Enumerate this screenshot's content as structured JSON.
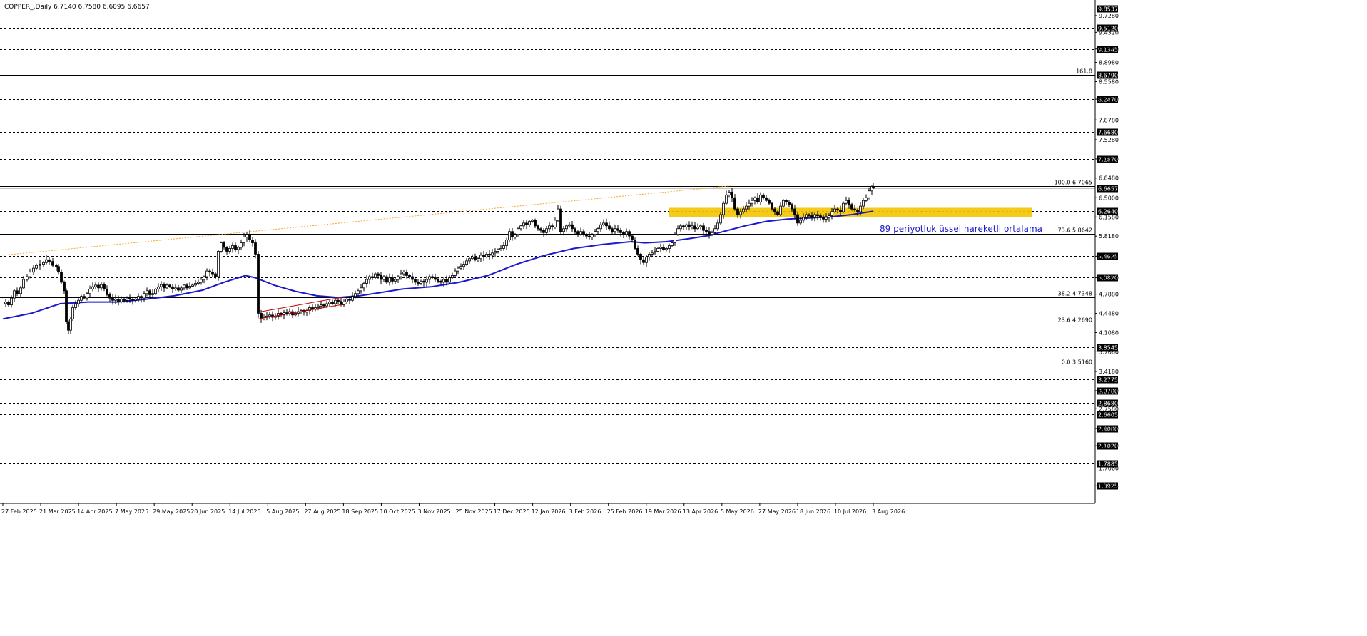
{
  "header": {
    "symbol_info": "COPPER_,Daily  6.7140 6.7580 6.6095 6.6657"
  },
  "chart_data": {
    "type": "candlestick",
    "title": "COPPER_,Daily  6.7140 6.7580 6.6095 6.6657",
    "ylim": [
      1.08,
      9.98
    ],
    "price_axis_ticks": [
      "9.7280",
      "9.4320",
      "9.1360",
      "8.8980",
      "8.5580",
      "8.2470",
      "7.8780",
      "7.5280",
      "7.1870",
      "6.8480",
      "6.5000",
      "6.1580",
      "5.8180",
      "5.4625",
      "5.0820",
      "4.7880",
      "4.4480",
      "4.1080",
      "3.7680",
      "3.4180",
      "3.0780",
      "2.7580",
      "2.4080",
      "2.1020",
      "1.7060",
      "1.3925"
    ],
    "price_axis_ticks_values": [
      9.728,
      9.432,
      9.136,
      8.898,
      8.558,
      8.247,
      7.878,
      7.528,
      7.187,
      6.848,
      6.5,
      6.158,
      5.818,
      5.4625,
      5.082,
      4.788,
      4.448,
      4.108,
      3.768,
      3.418,
      3.078,
      2.758,
      2.408,
      2.102,
      1.706,
      1.3925
    ],
    "x_axis_labels": [
      "27 Feb 2025",
      "21 Mar 2025",
      "14 Apr 2025",
      "7 May 2025",
      "29 May 2025",
      "20 Jun 2025",
      "14 Jul 2025",
      "5 Aug 2025",
      "27 Aug 2025",
      "18 Sep 2025",
      "10 Oct 2025",
      "3 Nov 2025",
      "25 Nov 2025",
      "17 Dec 2025",
      "12 Jan 2026",
      "3 Feb 2026",
      "25 Feb 2026",
      "19 Mar 2026",
      "13 Apr 2026",
      "5 May 2026",
      "27 May 2026",
      "18 Jun 2026",
      "10 Jul 2026",
      "3 Aug 2026"
    ],
    "horizontal_levels": [
      {
        "value": 9.8537,
        "label": "9.8537",
        "style": "dashed"
      },
      {
        "value": 9.512,
        "label": "9.5120",
        "style": "dashed"
      },
      {
        "value": 9.1345,
        "label": "9.1345",
        "style": "dashed"
      },
      {
        "value": 8.679,
        "label": "8.6790",
        "style": "solid",
        "note": "161.8"
      },
      {
        "value": 8.247,
        "label": "8.2470",
        "style": "dashed"
      },
      {
        "value": 7.668,
        "label": "7.6680",
        "style": "dashed"
      },
      {
        "value": 7.187,
        "label": "7.1870",
        "style": "dashed"
      },
      {
        "value": 6.7065,
        "label": "",
        "style": "solid",
        "note": "100.0 6.7065"
      },
      {
        "value": 6.6657,
        "label": "6.6657",
        "style": "none",
        "current": true
      },
      {
        "value": 6.264,
        "label": "6.2640",
        "style": "dashed"
      },
      {
        "value": 5.8642,
        "label": "",
        "style": "solid",
        "note": "73.6 5.8642"
      },
      {
        "value": 5.4625,
        "label": "5.4625",
        "style": "dashed"
      },
      {
        "value": 5.082,
        "label": "5.0820",
        "style": "dashed"
      },
      {
        "value": 4.7348,
        "label": "",
        "style": "solid",
        "note": "38.2 4.7348"
      },
      {
        "value": 4.269,
        "label": "",
        "style": "solid",
        "note": "23.6 4.2690"
      },
      {
        "value": 3.8545,
        "label": "3.8545",
        "style": "dashed"
      },
      {
        "value": 3.516,
        "label": "",
        "style": "solid",
        "note": "0.0 3.5160"
      },
      {
        "value": 3.2775,
        "label": "3.2775",
        "style": "dashed"
      },
      {
        "value": 3.078,
        "label": "3.0780",
        "style": "dashed"
      },
      {
        "value": 2.868,
        "label": "2.8680",
        "style": "dashed"
      },
      {
        "value": 2.6605,
        "label": "2.6605",
        "style": "dashed"
      },
      {
        "value": 2.408,
        "label": "2.4080",
        "style": "dashed"
      },
      {
        "value": 2.102,
        "label": "2.1020",
        "style": "dashed"
      },
      {
        "value": 1.7885,
        "label": "1.7885",
        "style": "dashed"
      },
      {
        "value": 1.3925,
        "label": "1.3925",
        "style": "dashed"
      }
    ],
    "price_path": [
      [
        0,
        4.62
      ],
      [
        4,
        4.65
      ],
      [
        8,
        4.6
      ],
      [
        12,
        4.72
      ],
      [
        16,
        4.85
      ],
      [
        20,
        4.8
      ],
      [
        25,
        4.9
      ],
      [
        29,
        5.05
      ],
      [
        34,
        5.1
      ],
      [
        38,
        5.18
      ],
      [
        43,
        5.25
      ],
      [
        47,
        5.3
      ],
      [
        52,
        5.32
      ],
      [
        57,
        5.35
      ],
      [
        61,
        5.4
      ],
      [
        65,
        5.37
      ],
      [
        70,
        5.3
      ],
      [
        75,
        5.28
      ],
      [
        78,
        5.18
      ],
      [
        82,
        5.0
      ],
      [
        86,
        4.85
      ],
      [
        89,
        4.3
      ],
      [
        92,
        4.15
      ],
      [
        95,
        4.35
      ],
      [
        98,
        4.55
      ],
      [
        102,
        4.62
      ],
      [
        106,
        4.68
      ],
      [
        110,
        4.75
      ],
      [
        114,
        4.72
      ],
      [
        118,
        4.8
      ],
      [
        122,
        4.88
      ],
      [
        126,
        4.92
      ],
      [
        130,
        4.95
      ],
      [
        134,
        4.9
      ],
      [
        138,
        4.96
      ],
      [
        142,
        4.88
      ],
      [
        146,
        4.78
      ],
      [
        150,
        4.72
      ],
      [
        154,
        4.68
      ],
      [
        158,
        4.7
      ],
      [
        162,
        4.65
      ],
      [
        166,
        4.7
      ],
      [
        170,
        4.68
      ],
      [
        174,
        4.72
      ],
      [
        178,
        4.7
      ],
      [
        182,
        4.68
      ],
      [
        186,
        4.7
      ],
      [
        190,
        4.75
      ],
      [
        194,
        4.72
      ],
      [
        198,
        4.8
      ],
      [
        202,
        4.85
      ],
      [
        206,
        4.78
      ],
      [
        210,
        4.8
      ],
      [
        214,
        4.88
      ],
      [
        218,
        4.92
      ],
      [
        222,
        4.96
      ],
      [
        226,
        4.9
      ],
      [
        230,
        4.95
      ],
      [
        234,
        4.92
      ],
      [
        238,
        4.88
      ],
      [
        242,
        4.9
      ],
      [
        246,
        4.86
      ],
      [
        250,
        4.9
      ],
      [
        254,
        4.95
      ],
      [
        258,
        4.9
      ],
      [
        262,
        4.93
      ],
      [
        266,
        4.95
      ],
      [
        270,
        4.98
      ],
      [
        274,
        5.0
      ],
      [
        278,
        5.05
      ],
      [
        282,
        5.1
      ],
      [
        286,
        5.2
      ],
      [
        290,
        5.18
      ],
      [
        294,
        5.15
      ],
      [
        298,
        5.1
      ],
      [
        302,
        5.55
      ],
      [
        306,
        5.7
      ],
      [
        310,
        5.62
      ],
      [
        314,
        5.55
      ],
      [
        318,
        5.6
      ],
      [
        322,
        5.65
      ],
      [
        326,
        5.58
      ],
      [
        330,
        5.62
      ],
      [
        334,
        5.7
      ],
      [
        338,
        5.8
      ],
      [
        342,
        5.85
      ],
      [
        346,
        5.75
      ],
      [
        350,
        5.7
      ],
      [
        354,
        5.5
      ],
      [
        358,
        4.45
      ],
      [
        362,
        4.35
      ],
      [
        366,
        4.38
      ],
      [
        370,
        4.4
      ],
      [
        374,
        4.42
      ],
      [
        378,
        4.38
      ],
      [
        382,
        4.4
      ],
      [
        386,
        4.45
      ],
      [
        390,
        4.42
      ],
      [
        394,
        4.46
      ],
      [
        398,
        4.44
      ],
      [
        402,
        4.48
      ],
      [
        406,
        4.42
      ],
      [
        410,
        4.45
      ],
      [
        414,
        4.48
      ],
      [
        418,
        4.5
      ],
      [
        422,
        4.47
      ],
      [
        426,
        4.5
      ],
      [
        430,
        4.55
      ],
      [
        434,
        4.52
      ],
      [
        438,
        4.55
      ],
      [
        442,
        4.58
      ],
      [
        446,
        4.6
      ],
      [
        450,
        4.58
      ],
      [
        454,
        4.62
      ],
      [
        458,
        4.65
      ],
      [
        462,
        4.62
      ],
      [
        466,
        4.68
      ],
      [
        470,
        4.66
      ],
      [
        474,
        4.6
      ],
      [
        478,
        4.65
      ],
      [
        482,
        4.7
      ],
      [
        486,
        4.68
      ],
      [
        490,
        4.75
      ],
      [
        494,
        4.8
      ],
      [
        498,
        4.85
      ],
      [
        502,
        4.9
      ],
      [
        506,
        4.98
      ],
      [
        510,
        5.05
      ],
      [
        514,
        5.1
      ],
      [
        518,
        5.08
      ],
      [
        522,
        5.15
      ],
      [
        526,
        5.12
      ],
      [
        530,
        5.05
      ],
      [
        534,
        5.1
      ],
      [
        538,
        5.0
      ],
      [
        542,
        5.08
      ],
      [
        546,
        5.02
      ],
      [
        550,
        5.05
      ],
      [
        554,
        5.1
      ],
      [
        558,
        5.15
      ],
      [
        562,
        5.18
      ],
      [
        566,
        5.12
      ],
      [
        570,
        5.1
      ],
      [
        574,
        5.05
      ],
      [
        578,
        5.0
      ],
      [
        582,
        4.98
      ],
      [
        586,
        5.02
      ],
      [
        590,
        5.0
      ],
      [
        594,
        5.05
      ],
      [
        598,
        5.1
      ],
      [
        602,
        5.08
      ],
      [
        606,
        5.05
      ],
      [
        610,
        5.02
      ],
      [
        614,
        5.0
      ],
      [
        618,
        5.05
      ],
      [
        622,
        5.0
      ],
      [
        626,
        5.08
      ],
      [
        630,
        5.12
      ],
      [
        634,
        5.2
      ],
      [
        638,
        5.25
      ],
      [
        642,
        5.28
      ],
      [
        646,
        5.32
      ],
      [
        650,
        5.38
      ],
      [
        654,
        5.42
      ],
      [
        658,
        5.45
      ],
      [
        662,
        5.4
      ],
      [
        666,
        5.42
      ],
      [
        670,
        5.48
      ],
      [
        674,
        5.45
      ],
      [
        678,
        5.5
      ],
      [
        682,
        5.48
      ],
      [
        686,
        5.52
      ],
      [
        690,
        5.55
      ],
      [
        694,
        5.58
      ],
      [
        698,
        5.6
      ],
      [
        702,
        5.65
      ],
      [
        706,
        5.75
      ],
      [
        710,
        5.9
      ],
      [
        714,
        5.8
      ],
      [
        718,
        5.85
      ],
      [
        722,
        5.95
      ],
      [
        726,
        6.0
      ],
      [
        730,
        6.05
      ],
      [
        734,
        6.02
      ],
      [
        738,
        6.08
      ],
      [
        742,
        6.1
      ],
      [
        746,
        6.0
      ],
      [
        750,
        5.95
      ],
      [
        754,
        5.92
      ],
      [
        758,
        5.88
      ],
      [
        762,
        5.95
      ],
      [
        766,
        6.0
      ],
      [
        770,
        5.98
      ],
      [
        774,
        6.1
      ],
      [
        778,
        6.3
      ],
      [
        782,
        5.9
      ],
      [
        786,
        5.95
      ],
      [
        790,
        6.0
      ],
      [
        794,
        6.02
      ],
      [
        798,
        5.95
      ],
      [
        802,
        5.9
      ],
      [
        806,
        5.85
      ],
      [
        810,
        5.9
      ],
      [
        814,
        5.85
      ],
      [
        818,
        5.82
      ],
      [
        822,
        5.8
      ],
      [
        826,
        5.85
      ],
      [
        830,
        5.9
      ],
      [
        834,
        5.95
      ],
      [
        838,
        6.02
      ],
      [
        842,
        6.05
      ],
      [
        846,
        6.0
      ],
      [
        850,
        5.95
      ],
      [
        854,
        5.9
      ],
      [
        858,
        5.95
      ],
      [
        862,
        5.92
      ],
      [
        866,
        5.88
      ],
      [
        870,
        5.85
      ],
      [
        874,
        5.9
      ],
      [
        878,
        5.82
      ],
      [
        882,
        5.75
      ],
      [
        886,
        5.6
      ],
      [
        890,
        5.5
      ],
      [
        894,
        5.4
      ],
      [
        898,
        5.35
      ],
      [
        902,
        5.45
      ],
      [
        906,
        5.5
      ],
      [
        910,
        5.52
      ],
      [
        914,
        5.55
      ],
      [
        918,
        5.6
      ],
      [
        922,
        5.62
      ],
      [
        926,
        5.58
      ],
      [
        930,
        5.6
      ],
      [
        934,
        5.65
      ],
      [
        938,
        5.7
      ],
      [
        942,
        5.85
      ],
      [
        946,
        5.95
      ],
      [
        950,
        6.0
      ],
      [
        954,
        5.98
      ],
      [
        958,
        6.02
      ],
      [
        962,
        5.98
      ],
      [
        966,
        6.0
      ],
      [
        970,
        5.95
      ],
      [
        974,
        5.98
      ],
      [
        978,
        6.0
      ],
      [
        982,
        5.92
      ],
      [
        986,
        5.9
      ],
      [
        990,
        5.85
      ],
      [
        994,
        5.88
      ],
      [
        998,
        5.95
      ],
      [
        1002,
        6.05
      ],
      [
        1006,
        6.2
      ],
      [
        1010,
        6.4
      ],
      [
        1014,
        6.55
      ],
      [
        1018,
        6.6
      ],
      [
        1022,
        6.5
      ],
      [
        1026,
        6.3
      ],
      [
        1030,
        6.2
      ],
      [
        1034,
        6.25
      ],
      [
        1038,
        6.3
      ],
      [
        1042,
        6.35
      ],
      [
        1046,
        6.4
      ],
      [
        1050,
        6.45
      ],
      [
        1054,
        6.5
      ],
      [
        1058,
        6.42
      ],
      [
        1062,
        6.55
      ],
      [
        1066,
        6.5
      ],
      [
        1070,
        6.45
      ],
      [
        1074,
        6.4
      ],
      [
        1078,
        6.3
      ],
      [
        1082,
        6.25
      ],
      [
        1086,
        6.2
      ],
      [
        1090,
        6.35
      ],
      [
        1094,
        6.45
      ],
      [
        1098,
        6.42
      ],
      [
        1102,
        6.38
      ],
      [
        1106,
        6.3
      ],
      [
        1110,
        6.2
      ],
      [
        1114,
        6.05
      ],
      [
        1118,
        6.1
      ],
      [
        1122,
        6.15
      ],
      [
        1126,
        6.2
      ],
      [
        1130,
        6.18
      ],
      [
        1134,
        6.15
      ],
      [
        1138,
        6.2
      ],
      [
        1142,
        6.18
      ],
      [
        1146,
        6.15
      ],
      [
        1150,
        6.12
      ],
      [
        1154,
        6.15
      ],
      [
        1158,
        6.18
      ],
      [
        1162,
        6.25
      ],
      [
        1166,
        6.3
      ],
      [
        1170,
        6.28
      ],
      [
        1174,
        6.25
      ],
      [
        1178,
        6.4
      ],
      [
        1182,
        6.45
      ],
      [
        1186,
        6.38
      ],
      [
        1190,
        6.3
      ],
      [
        1194,
        6.28
      ],
      [
        1198,
        6.25
      ],
      [
        1202,
        6.35
      ],
      [
        1206,
        6.45
      ],
      [
        1210,
        6.5
      ],
      [
        1214,
        6.62
      ],
      [
        1218,
        6.7
      ],
      [
        1220,
        6.67
      ]
    ],
    "ema_path": [
      [
        0,
        4.35
      ],
      [
        40,
        4.45
      ],
      [
        80,
        4.62
      ],
      [
        120,
        4.65
      ],
      [
        160,
        4.65
      ],
      [
        200,
        4.7
      ],
      [
        240,
        4.76
      ],
      [
        280,
        4.86
      ],
      [
        310,
        5.0
      ],
      [
        340,
        5.12
      ],
      [
        354,
        5.08
      ],
      [
        380,
        4.95
      ],
      [
        410,
        4.84
      ],
      [
        440,
        4.76
      ],
      [
        470,
        4.73
      ],
      [
        500,
        4.76
      ],
      [
        530,
        4.82
      ],
      [
        560,
        4.88
      ],
      [
        600,
        4.92
      ],
      [
        640,
        5.0
      ],
      [
        680,
        5.12
      ],
      [
        720,
        5.32
      ],
      [
        760,
        5.48
      ],
      [
        800,
        5.6
      ],
      [
        840,
        5.67
      ],
      [
        880,
        5.72
      ],
      [
        900,
        5.7
      ],
      [
        930,
        5.72
      ],
      [
        960,
        5.77
      ],
      [
        990,
        5.83
      ],
      [
        1010,
        5.9
      ],
      [
        1040,
        6.0
      ],
      [
        1070,
        6.08
      ],
      [
        1100,
        6.12
      ],
      [
        1130,
        6.14
      ],
      [
        1160,
        6.16
      ],
      [
        1190,
        6.2
      ],
      [
        1220,
        6.26
      ]
    ],
    "ema_label": "89 periyotluk üssel hareketli ortalama",
    "colors": {
      "up_candle": "#000000",
      "down_candle": "#000000",
      "ema": "#1a1acc",
      "support_zone": "#f5c400",
      "trendline": "#f5a623",
      "channel": "#c00000",
      "ema_label": "#1a1acc"
    },
    "support_zone_range": [
      6.15,
      6.32
    ],
    "trendline_points": [
      [
        0,
        5.48
      ],
      [
        1020,
        6.71
      ]
    ],
    "channel_lines": [
      [
        [
          358,
          4.35
        ],
        [
          482,
          4.62
        ]
      ],
      [
        [
          358,
          4.47
        ],
        [
          482,
          4.75
        ]
      ]
    ],
    "grid": false,
    "legend": "none"
  }
}
